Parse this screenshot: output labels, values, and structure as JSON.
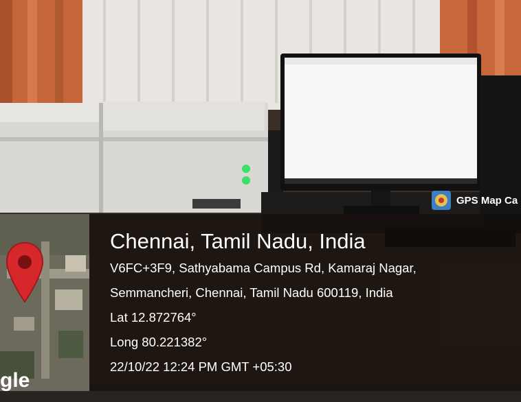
{
  "location": {
    "city_line": "Chennai, Tamil Nadu, India",
    "address_line1": "V6FC+3F9, Sathyabama Campus Rd, Kamaraj Nagar,",
    "address_line2": "Semmancheri, Chennai, Tamil Nadu 600119, India",
    "latitude": "Lat 12.872764°",
    "longitude": "Long 80.221382°",
    "datetime": "22/10/22 12:24 PM GMT +05:30"
  },
  "map_thumbnail": {
    "provider_mark": "gle",
    "pin_icon": "map-pin-icon"
  },
  "watermark": {
    "app_label": "GPS Map Ca",
    "icon": "gps-map-camera-icon"
  },
  "colors": {
    "pin": "#d6282b",
    "overlay": "#140e0a",
    "text": "#ffffff"
  }
}
